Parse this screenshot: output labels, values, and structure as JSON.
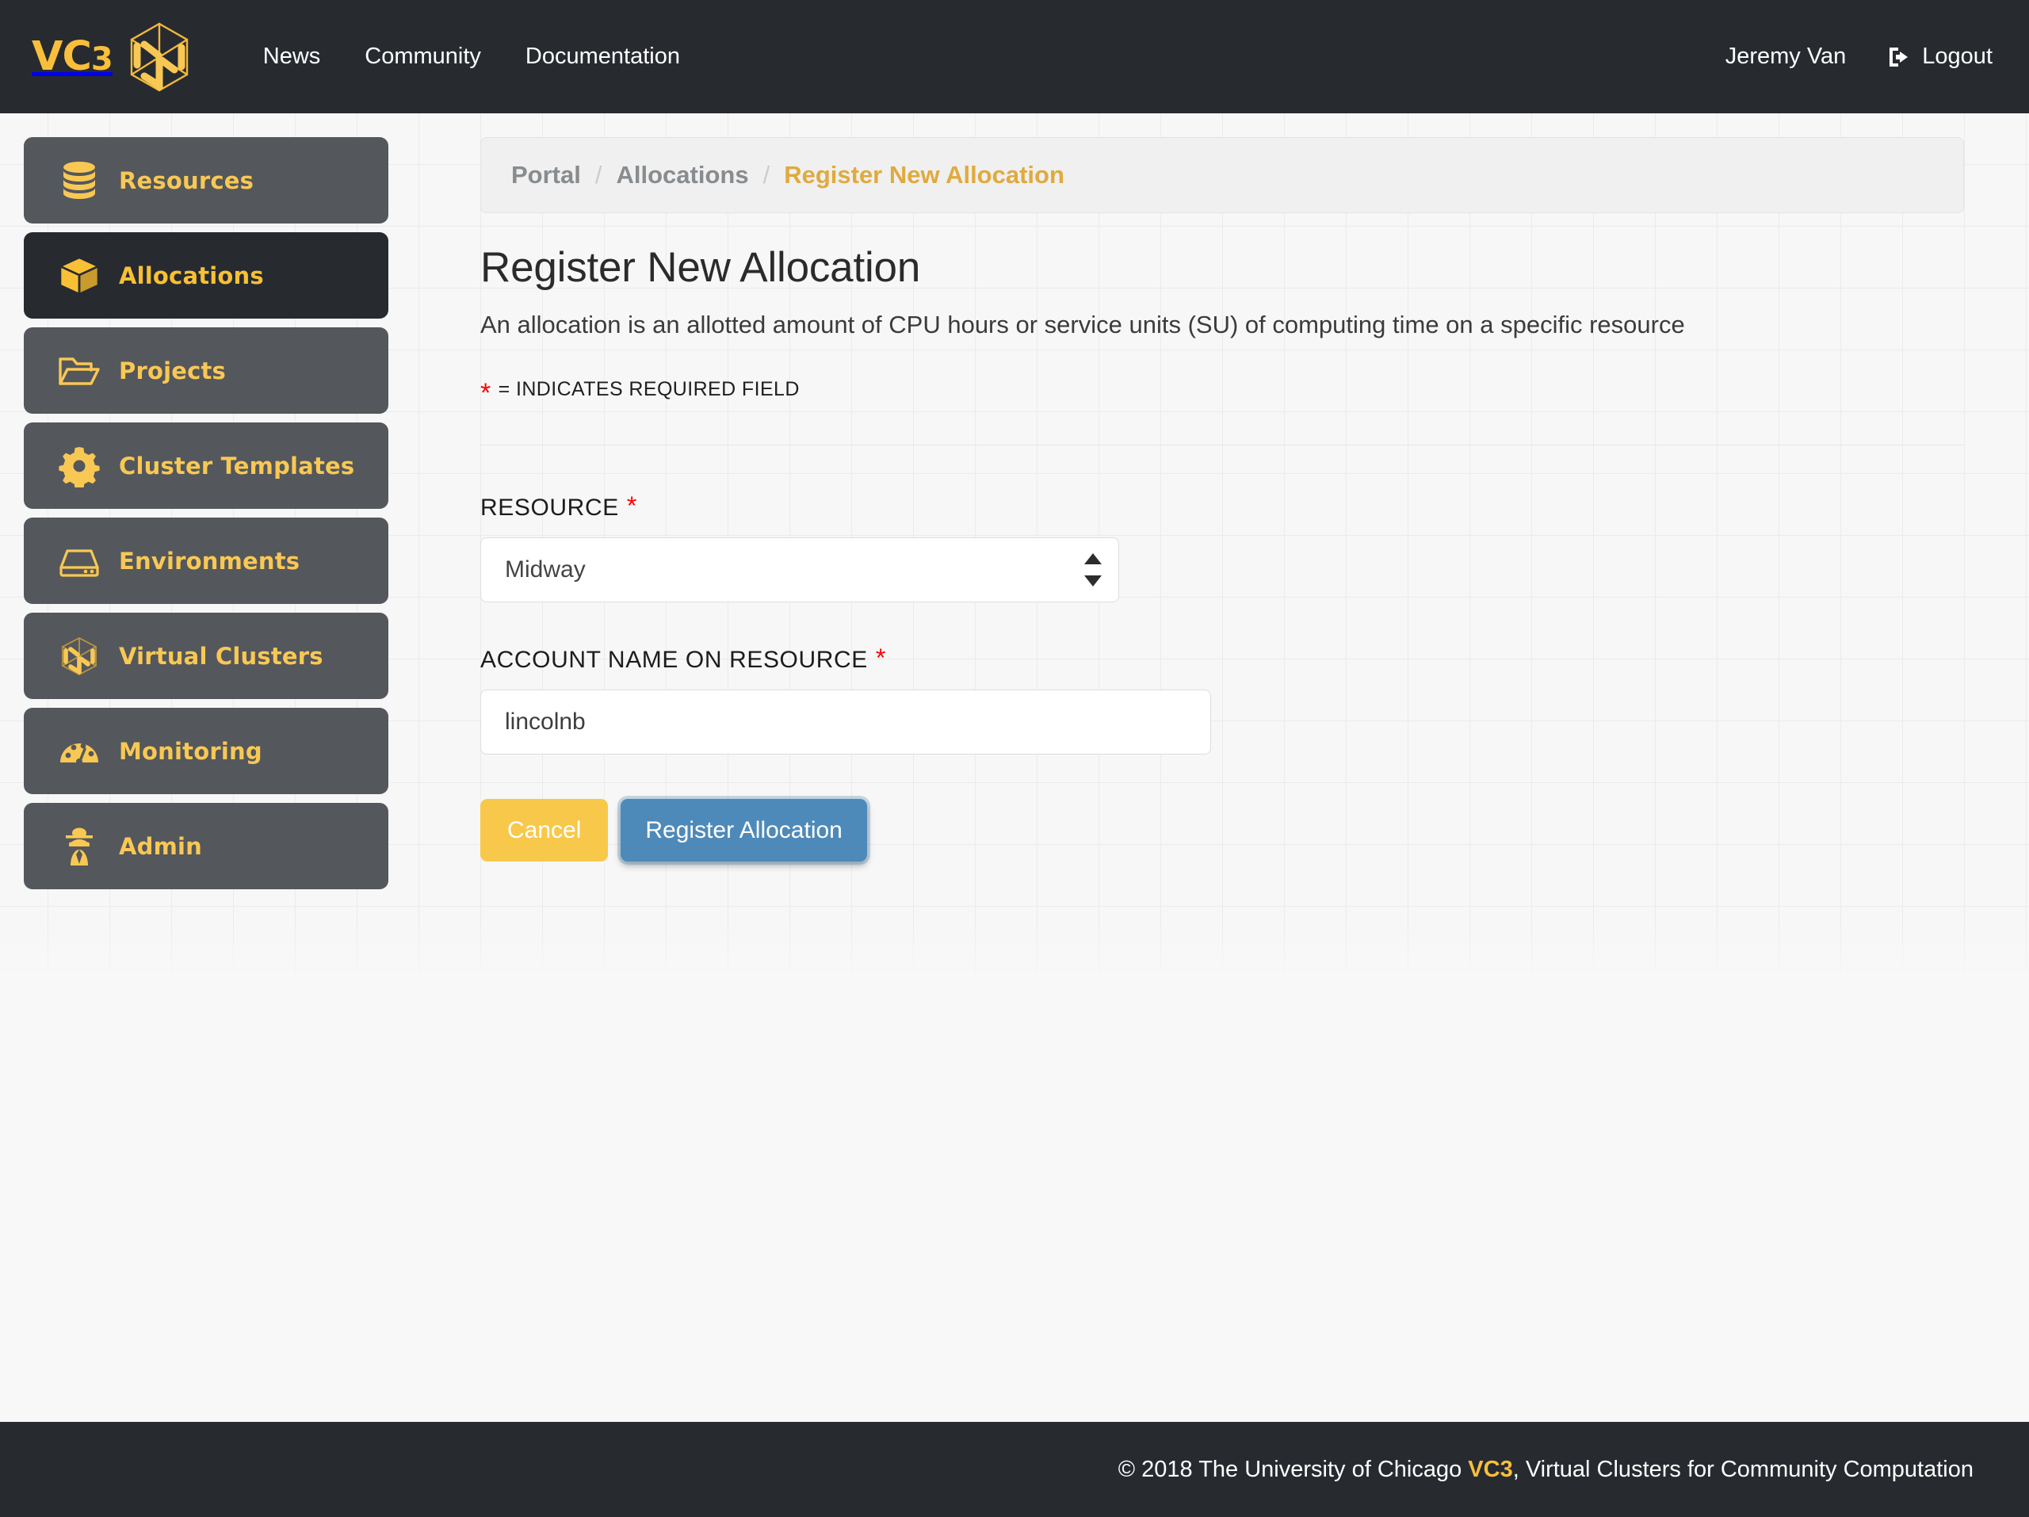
{
  "navbar": {
    "brand_main": "VC",
    "brand_sub": "3",
    "brand_logo_icon": "vc3-hexagon-logo-icon",
    "links": [
      {
        "label": "News"
      },
      {
        "label": "Community"
      },
      {
        "label": "Documentation"
      }
    ],
    "user_name": "Jeremy Van",
    "logout_label": "Logout",
    "logout_icon": "sign-out-icon"
  },
  "sidebar": {
    "items": [
      {
        "label": "Resources",
        "icon": "database-icon",
        "active": false
      },
      {
        "label": "Allocations",
        "icon": "cube-box-icon",
        "active": true
      },
      {
        "label": "Projects",
        "icon": "open-folder-icon",
        "active": false
      },
      {
        "label": "Cluster Templates",
        "icon": "gear-icon",
        "active": false
      },
      {
        "label": "Environments",
        "icon": "hard-drive-icon",
        "active": false
      },
      {
        "label": "Virtual Clusters",
        "icon": "hexagon-cluster-icon",
        "active": false
      },
      {
        "label": "Monitoring",
        "icon": "gauge-icon",
        "active": false
      },
      {
        "label": "Admin",
        "icon": "spy-detective-icon",
        "active": false
      }
    ]
  },
  "breadcrumb": {
    "items": [
      {
        "label": "Portal",
        "current": false
      },
      {
        "label": "Allocations",
        "current": false
      },
      {
        "label": "Register New Allocation",
        "current": true
      }
    ],
    "separator": "/"
  },
  "main": {
    "title": "Register New Allocation",
    "description": "An allocation is an allotted amount of CPU hours or service units (SU) of computing time on a specific resource",
    "required_note": "= INDICATES REQUIRED FIELD",
    "required_marker": "*"
  },
  "form": {
    "resource": {
      "label": "RESOURCE",
      "required_marker": "*",
      "selected_value": "Midway",
      "options": [
        "Midway"
      ]
    },
    "account_name": {
      "label": "ACCOUNT NAME ON RESOURCE",
      "required_marker": "*",
      "value": "lincolnb",
      "placeholder": ""
    },
    "cancel_label": "Cancel",
    "submit_label": "Register Allocation"
  },
  "footer": {
    "prefix": "© 2018 The University of Chicago ",
    "vc3": "VC3",
    "suffix": ", Virtual Clusters for Community Computation"
  },
  "colors": {
    "dark": "#272b30",
    "brand_yellow": "#f9bf3b",
    "sidebar_gray": "#54585c",
    "primary_blue": "#4e8ab9",
    "cancel_yellow": "#f8c84a",
    "required_red": "#ff0000"
  }
}
